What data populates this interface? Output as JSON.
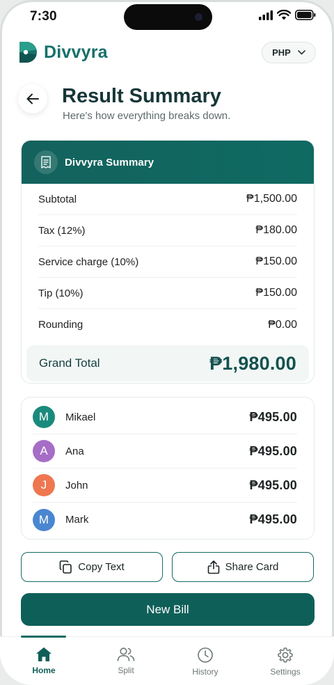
{
  "status": {
    "time": "7:30"
  },
  "header": {
    "brand": "Divvyra",
    "currency": "PHP"
  },
  "page": {
    "title": "Result Summary",
    "subtitle": "Here's how everything breaks down."
  },
  "summary": {
    "heading": "Divvyra Summary",
    "rows": [
      {
        "label": "Subtotal",
        "amount": "₱1,500.00"
      },
      {
        "label": "Tax (12%)",
        "amount": "₱180.00"
      },
      {
        "label": "Service charge (10%)",
        "amount": "₱150.00"
      },
      {
        "label": "Tip (10%)",
        "amount": "₱150.00"
      },
      {
        "label": "Rounding",
        "amount": "₱0.00"
      }
    ],
    "grand_total_label": "Grand Total",
    "grand_total_amount": "₱1,980.00"
  },
  "people": [
    {
      "initial": "M",
      "name": "Mikael",
      "amount": "₱495.00",
      "color": "#1a8a7d"
    },
    {
      "initial": "A",
      "name": "Ana",
      "amount": "₱495.00",
      "color": "#a66dc6"
    },
    {
      "initial": "J",
      "name": "John",
      "amount": "₱495.00",
      "color": "#ee7750"
    },
    {
      "initial": "M",
      "name": "Mark",
      "amount": "₱495.00",
      "color": "#4a87cf"
    }
  ],
  "actions": {
    "copy": "Copy Text",
    "share": "Share Card",
    "new_bill": "New Bill"
  },
  "tabs": [
    {
      "label": "Home",
      "icon": "home-icon",
      "active": true
    },
    {
      "label": "Split",
      "icon": "users-icon",
      "active": false
    },
    {
      "label": "History",
      "icon": "clock-icon",
      "active": false
    },
    {
      "label": "Settings",
      "icon": "gear-icon",
      "active": false
    }
  ],
  "colors": {
    "primary": "#0f5f59",
    "brand": "#17706a"
  }
}
